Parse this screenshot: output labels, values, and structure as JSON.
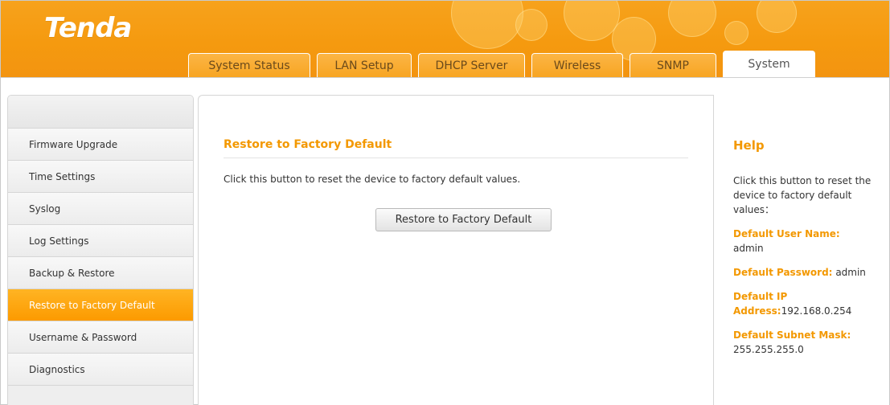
{
  "brand": {
    "logo": "Tenda"
  },
  "tabs": [
    {
      "label": "System Status",
      "active": false
    },
    {
      "label": "LAN Setup",
      "active": false
    },
    {
      "label": "DHCP Server",
      "active": false
    },
    {
      "label": "Wireless",
      "active": false
    },
    {
      "label": "SNMP",
      "active": false
    },
    {
      "label": "System",
      "active": true
    }
  ],
  "sidebar": {
    "items": [
      {
        "label": "Firmware Upgrade"
      },
      {
        "label": "Time Settings"
      },
      {
        "label": "Syslog"
      },
      {
        "label": "Log Settings"
      },
      {
        "label": "Backup & Restore"
      },
      {
        "label": "Restore to Factory Default",
        "active": true
      },
      {
        "label": "Username & Password"
      },
      {
        "label": "Diagnostics"
      }
    ]
  },
  "main": {
    "title": "Restore to Factory Default",
    "description": "Click this button to reset the device to factory default values.",
    "button_label": "Restore to Factory Default"
  },
  "help": {
    "title": "Help",
    "intro": "Click this button to reset the device to factory default values：",
    "user_name_label": "Default User Name:",
    "user_name_value": "admin",
    "password_label": "Default Password:",
    "password_value": "admin",
    "ip_label": "Default IP Address:",
    "ip_value": "192.168.0.254",
    "mask_label": "Default Subnet Mask:",
    "mask_value": "255.255.255.0"
  },
  "colors": {
    "brand_orange": "#f39800",
    "active_item": "#fc9a00"
  }
}
